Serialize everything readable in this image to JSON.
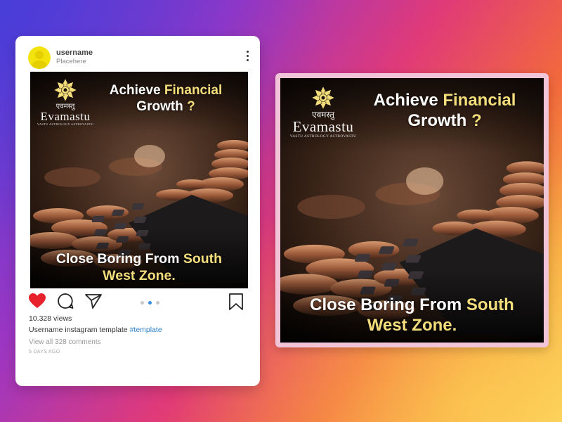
{
  "post": {
    "username": "username",
    "subtitle": "Placehere",
    "views": "10.328 views",
    "caption_user": "Username",
    "caption_text": " instagram template ",
    "hashtag": "#template",
    "comments_link": "View all 328 comments",
    "timestamp": "5 DAYS AGO",
    "carousel": {
      "count": 3,
      "active": 2
    }
  },
  "poster": {
    "logo_hindi": "एवमस्तु",
    "logo_brand": "Evamastu",
    "logo_tagline": "VASTU ASTROLOGY ASTROVASTU",
    "headline_1": "Achieve ",
    "headline_accent": "Financial",
    "headline_2": "Growth ",
    "headline_qmark": "?",
    "footer_1": "Close Boring From ",
    "footer_accent": "South",
    "footer_2": "West Zone."
  },
  "icons": {
    "like": "heart-icon",
    "comment": "comment-icon",
    "share": "share-icon",
    "save": "bookmark-icon",
    "more": "more-vertical-icon",
    "logo": "lotus-mandala-icon"
  },
  "colors": {
    "accent_gold": "#f3de7b",
    "like_red": "#e8222c",
    "hashtag_blue": "#2f7fc7",
    "carousel_active": "#3a8ee6",
    "frame_border": "#f2c4d7"
  }
}
